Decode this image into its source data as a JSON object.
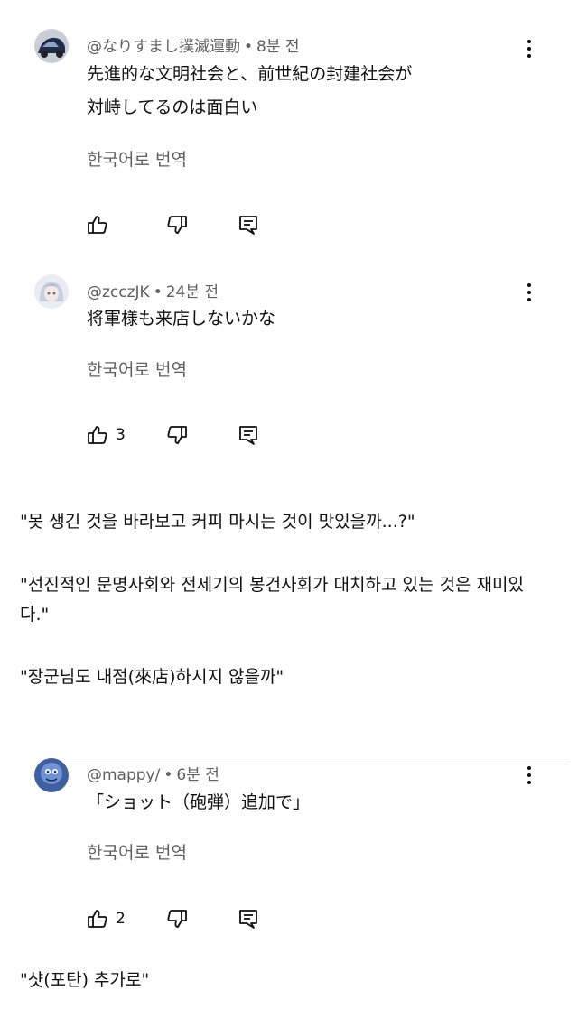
{
  "comments": [
    {
      "handle": "@なりすまし撲滅運動",
      "time": "8분 전",
      "lines": [
        "先進的な文明社会と、前世紀の封建社会が",
        "対峙してるのは面白い"
      ],
      "translate": "한국어로 번역",
      "like_count": "",
      "avatar_icon": "car-avatar-icon"
    },
    {
      "handle": "@zcczJK",
      "time": "24분 전",
      "lines": [
        "将軍様も来店しないかな"
      ],
      "translate": "한국어로 번역",
      "like_count": "3",
      "avatar_icon": "anime-avatar-icon"
    },
    {
      "handle": "@mappy/",
      "time": "6분 전",
      "lines": [
        "「ショット（砲弾）追加で」"
      ],
      "translate": "한국어로 번역",
      "like_count": "2",
      "avatar_icon": "blue-character-avatar-icon"
    }
  ],
  "quotes": [
    "\"못 생긴 것을 바라보고 커피 마시는 것이 맛있을까...?\"",
    "\"선진적인 문명사회와 전세기의 봉건사회가 대치하고 있는 것은 재미있",
    "다.\"",
    "\"장군님도 내점(來店)하시지 않을까\"",
    "\"샷(포탄) 추가로\""
  ],
  "separator": "•",
  "icons": {
    "like": "thumbs-up-icon",
    "dislike": "thumbs-down-icon",
    "reply": "reply-icon",
    "more": "more-vertical-icon"
  }
}
